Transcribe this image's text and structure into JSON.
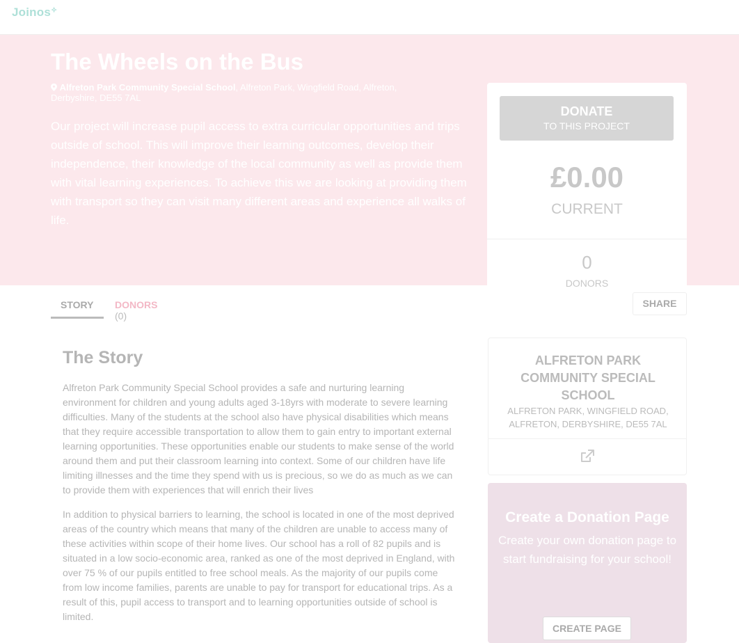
{
  "header": {
    "logo_text": "Joinos",
    "logo_mark": "✧"
  },
  "project": {
    "title": "The Wheels on the Bus",
    "school_name": "Alfreton Park Community Special School",
    "address_rest": ", Alfreton Park, Wingfield Road, Alfreton, Derbyshire, DE55 7AL",
    "pin_icon": "map-pin-icon",
    "description": "Our project will increase pupil access to extra curricular opportunities and trips outside of school. This will improve their learning outcomes, develop their independence, their knowledge of the local community as well as provide them with vital learning experiences. To achieve this we are looking at providing them with transport so they can visit many different areas and experience all walks of life."
  },
  "donate_card": {
    "button_main": "DONATE",
    "button_sub": "TO THIS PROJECT",
    "amount": "£0.00",
    "amount_label": "CURRENT",
    "donors_count": "0",
    "donors_label": "DONORS"
  },
  "tabs": {
    "story_label": "STORY",
    "donors_label": "DONORS",
    "donors_count": "(0)",
    "share_label": "SHARE"
  },
  "story": {
    "title": "The Story",
    "paragraph1": "Alfreton Park Community Special School provides a safe and nurturing learning environment for children and young adults aged 3-18yrs with moderate to severe learning difficulties. Many of the students at the school also have physical disabilities which means that they require accessible transportation to allow them to gain entry to important external learning opportunities. These opportunities enable our students to make sense of the world around them and put their classroom learning into context. Some of our children have life limiting illnesses and the time they spend with us is precious, so we do as much as we can to provide them with experiences that will enrich their lives",
    "paragraph2": "In addition to physical barriers to learning, the school is located in one of the most deprived areas of the country which means that many of the children are unable to access many of these activities within scope of their home lives. Our school has a roll of 82 pupils and is situated in a low socio-economic area, ranked as one of the most deprived in England, with over 75 % of our pupils entitled to free school meals. As the majority of our pupils come from low income families, parents are unable to pay for transport for educational trips. As a result of this, pupil access to transport and to learning opportunities outside of school is limited."
  },
  "school_card": {
    "name": "ALFRETON PARK COMMUNITY SPECIAL SCHOOL",
    "address": "ALFRETON PARK, WINGFIELD ROAD, ALFRETON, DERBYSHIRE, DE55 7AL",
    "link_icon": "external-link-icon"
  },
  "create_card": {
    "title": "Create a Donation Page",
    "description": "Create your own donation page to start fundraising for your school!",
    "button_label": "CREATE PAGE"
  }
}
